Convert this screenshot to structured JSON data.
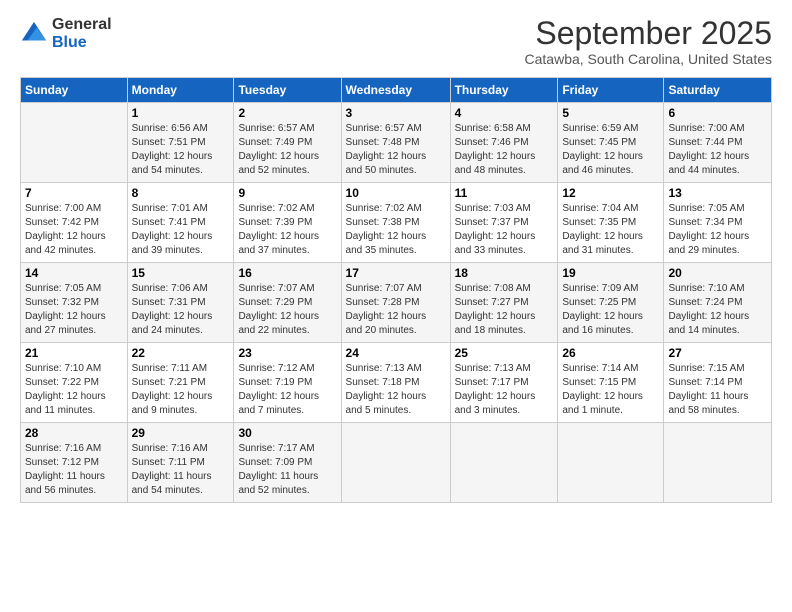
{
  "logo": {
    "line1": "General",
    "line2": "Blue"
  },
  "title": "September 2025",
  "location": "Catawba, South Carolina, United States",
  "days_of_week": [
    "Sunday",
    "Monday",
    "Tuesday",
    "Wednesday",
    "Thursday",
    "Friday",
    "Saturday"
  ],
  "weeks": [
    [
      {
        "num": "",
        "sunrise": "",
        "sunset": "",
        "daylight": ""
      },
      {
        "num": "1",
        "sunrise": "Sunrise: 6:56 AM",
        "sunset": "Sunset: 7:51 PM",
        "daylight": "Daylight: 12 hours and 54 minutes."
      },
      {
        "num": "2",
        "sunrise": "Sunrise: 6:57 AM",
        "sunset": "Sunset: 7:49 PM",
        "daylight": "Daylight: 12 hours and 52 minutes."
      },
      {
        "num": "3",
        "sunrise": "Sunrise: 6:57 AM",
        "sunset": "Sunset: 7:48 PM",
        "daylight": "Daylight: 12 hours and 50 minutes."
      },
      {
        "num": "4",
        "sunrise": "Sunrise: 6:58 AM",
        "sunset": "Sunset: 7:46 PM",
        "daylight": "Daylight: 12 hours and 48 minutes."
      },
      {
        "num": "5",
        "sunrise": "Sunrise: 6:59 AM",
        "sunset": "Sunset: 7:45 PM",
        "daylight": "Daylight: 12 hours and 46 minutes."
      },
      {
        "num": "6",
        "sunrise": "Sunrise: 7:00 AM",
        "sunset": "Sunset: 7:44 PM",
        "daylight": "Daylight: 12 hours and 44 minutes."
      }
    ],
    [
      {
        "num": "7",
        "sunrise": "Sunrise: 7:00 AM",
        "sunset": "Sunset: 7:42 PM",
        "daylight": "Daylight: 12 hours and 42 minutes."
      },
      {
        "num": "8",
        "sunrise": "Sunrise: 7:01 AM",
        "sunset": "Sunset: 7:41 PM",
        "daylight": "Daylight: 12 hours and 39 minutes."
      },
      {
        "num": "9",
        "sunrise": "Sunrise: 7:02 AM",
        "sunset": "Sunset: 7:39 PM",
        "daylight": "Daylight: 12 hours and 37 minutes."
      },
      {
        "num": "10",
        "sunrise": "Sunrise: 7:02 AM",
        "sunset": "Sunset: 7:38 PM",
        "daylight": "Daylight: 12 hours and 35 minutes."
      },
      {
        "num": "11",
        "sunrise": "Sunrise: 7:03 AM",
        "sunset": "Sunset: 7:37 PM",
        "daylight": "Daylight: 12 hours and 33 minutes."
      },
      {
        "num": "12",
        "sunrise": "Sunrise: 7:04 AM",
        "sunset": "Sunset: 7:35 PM",
        "daylight": "Daylight: 12 hours and 31 minutes."
      },
      {
        "num": "13",
        "sunrise": "Sunrise: 7:05 AM",
        "sunset": "Sunset: 7:34 PM",
        "daylight": "Daylight: 12 hours and 29 minutes."
      }
    ],
    [
      {
        "num": "14",
        "sunrise": "Sunrise: 7:05 AM",
        "sunset": "Sunset: 7:32 PM",
        "daylight": "Daylight: 12 hours and 27 minutes."
      },
      {
        "num": "15",
        "sunrise": "Sunrise: 7:06 AM",
        "sunset": "Sunset: 7:31 PM",
        "daylight": "Daylight: 12 hours and 24 minutes."
      },
      {
        "num": "16",
        "sunrise": "Sunrise: 7:07 AM",
        "sunset": "Sunset: 7:29 PM",
        "daylight": "Daylight: 12 hours and 22 minutes."
      },
      {
        "num": "17",
        "sunrise": "Sunrise: 7:07 AM",
        "sunset": "Sunset: 7:28 PM",
        "daylight": "Daylight: 12 hours and 20 minutes."
      },
      {
        "num": "18",
        "sunrise": "Sunrise: 7:08 AM",
        "sunset": "Sunset: 7:27 PM",
        "daylight": "Daylight: 12 hours and 18 minutes."
      },
      {
        "num": "19",
        "sunrise": "Sunrise: 7:09 AM",
        "sunset": "Sunset: 7:25 PM",
        "daylight": "Daylight: 12 hours and 16 minutes."
      },
      {
        "num": "20",
        "sunrise": "Sunrise: 7:10 AM",
        "sunset": "Sunset: 7:24 PM",
        "daylight": "Daylight: 12 hours and 14 minutes."
      }
    ],
    [
      {
        "num": "21",
        "sunrise": "Sunrise: 7:10 AM",
        "sunset": "Sunset: 7:22 PM",
        "daylight": "Daylight: 12 hours and 11 minutes."
      },
      {
        "num": "22",
        "sunrise": "Sunrise: 7:11 AM",
        "sunset": "Sunset: 7:21 PM",
        "daylight": "Daylight: 12 hours and 9 minutes."
      },
      {
        "num": "23",
        "sunrise": "Sunrise: 7:12 AM",
        "sunset": "Sunset: 7:19 PM",
        "daylight": "Daylight: 12 hours and 7 minutes."
      },
      {
        "num": "24",
        "sunrise": "Sunrise: 7:13 AM",
        "sunset": "Sunset: 7:18 PM",
        "daylight": "Daylight: 12 hours and 5 minutes."
      },
      {
        "num": "25",
        "sunrise": "Sunrise: 7:13 AM",
        "sunset": "Sunset: 7:17 PM",
        "daylight": "Daylight: 12 hours and 3 minutes."
      },
      {
        "num": "26",
        "sunrise": "Sunrise: 7:14 AM",
        "sunset": "Sunset: 7:15 PM",
        "daylight": "Daylight: 12 hours and 1 minute."
      },
      {
        "num": "27",
        "sunrise": "Sunrise: 7:15 AM",
        "sunset": "Sunset: 7:14 PM",
        "daylight": "Daylight: 11 hours and 58 minutes."
      }
    ],
    [
      {
        "num": "28",
        "sunrise": "Sunrise: 7:16 AM",
        "sunset": "Sunset: 7:12 PM",
        "daylight": "Daylight: 11 hours and 56 minutes."
      },
      {
        "num": "29",
        "sunrise": "Sunrise: 7:16 AM",
        "sunset": "Sunset: 7:11 PM",
        "daylight": "Daylight: 11 hours and 54 minutes."
      },
      {
        "num": "30",
        "sunrise": "Sunrise: 7:17 AM",
        "sunset": "Sunset: 7:09 PM",
        "daylight": "Daylight: 11 hours and 52 minutes."
      },
      {
        "num": "",
        "sunrise": "",
        "sunset": "",
        "daylight": ""
      },
      {
        "num": "",
        "sunrise": "",
        "sunset": "",
        "daylight": ""
      },
      {
        "num": "",
        "sunrise": "",
        "sunset": "",
        "daylight": ""
      },
      {
        "num": "",
        "sunrise": "",
        "sunset": "",
        "daylight": ""
      }
    ]
  ]
}
